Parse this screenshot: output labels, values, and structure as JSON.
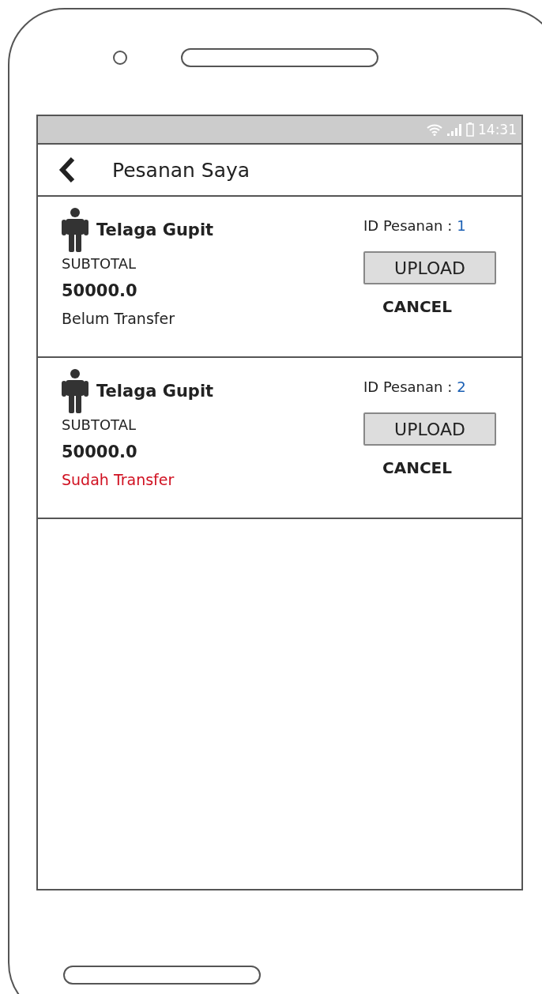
{
  "status_bar": {
    "time": "14:31"
  },
  "header": {
    "title": "Pesanan Saya"
  },
  "orders": [
    {
      "name": "Telaga Gupit",
      "id_label": "ID Pesanan :",
      "id": "1",
      "subtotal_label": "SUBTOTAL",
      "subtotal": "50000.0",
      "status": "Belum Transfer",
      "transferred": false,
      "upload_button": "UPLOAD",
      "cancel_button": "CANCEL"
    },
    {
      "name": "Telaga Gupit",
      "id_label": "ID Pesanan :",
      "id": "2",
      "subtotal_label": "SUBTOTAL",
      "subtotal": "50000.0",
      "status": "Sudah Transfer",
      "transferred": true,
      "upload_button": "UPLOAD",
      "cancel_button": "CANCEL"
    }
  ]
}
